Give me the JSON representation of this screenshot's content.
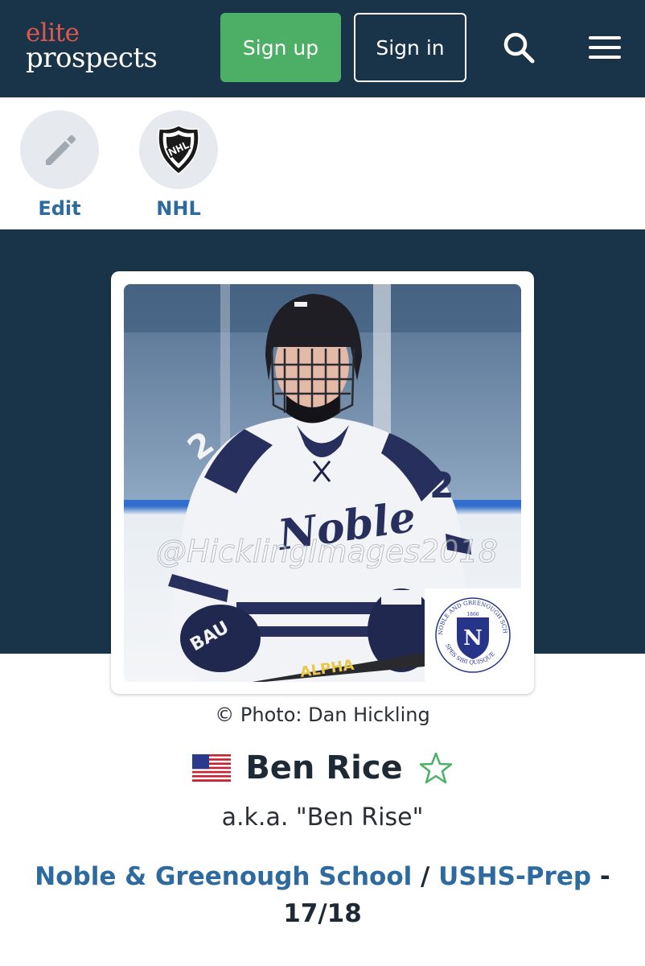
{
  "header": {
    "logo_line1": "elite",
    "logo_line2": "prospects",
    "signup_label": "Sign up",
    "signin_label": "Sign in",
    "search_icon": "search-icon",
    "menu_icon": "hamburger-menu-icon",
    "colors": {
      "background": "#193449",
      "signup": "#4caf65",
      "logo_accent": "#e0584a"
    }
  },
  "shortcuts": [
    {
      "label": "Edit",
      "icon": "pencil-icon"
    },
    {
      "label": "NHL",
      "icon": "nhl-shield-icon"
    }
  ],
  "profile": {
    "photo_credit": "© Photo: Dan Hickling",
    "photo_watermark": "@HicklingImages2018",
    "jersey_text": "Noble",
    "jersey_number": "2",
    "school_crest_text": "NOBLE AND GREENOUGH SCHOOL",
    "crest_motto": "SPES SIBI QUISQUE",
    "crest_year": "1866",
    "nationality_flag": "usa-flag-icon",
    "name": "Ben Rice",
    "favorite_icon": "star-outline-icon",
    "aka": "a.k.a. \"Ben Rise\"",
    "team": "Noble & Greenough School",
    "separator": "/",
    "league": "USHS-Prep",
    "dash": "-",
    "season": "17/18"
  },
  "colors": {
    "link": "#2d6a9f",
    "hero_band": "#193449",
    "star": "#4caf65"
  }
}
